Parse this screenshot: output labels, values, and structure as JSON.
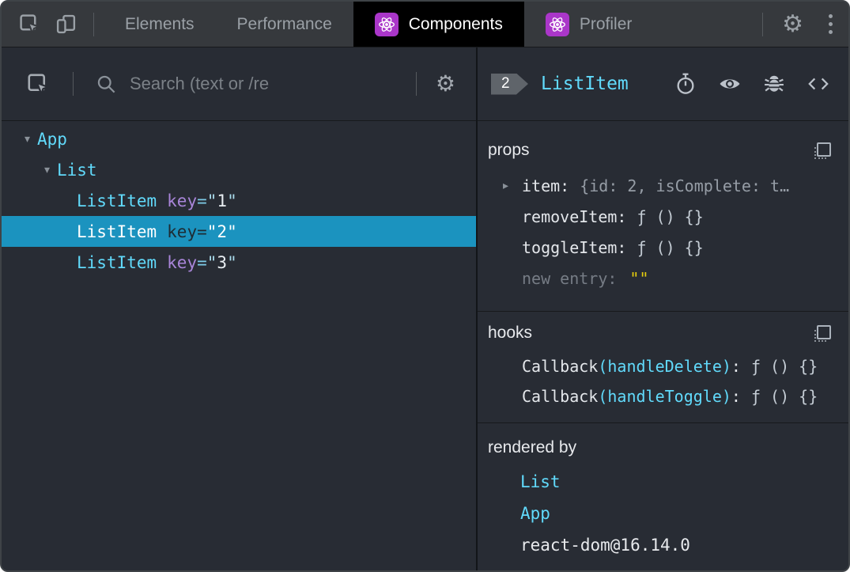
{
  "tabbar": {
    "tabs": [
      {
        "label": "Elements"
      },
      {
        "label": "Performance"
      },
      {
        "label": "Components",
        "active": true,
        "icon": "react-logo"
      },
      {
        "label": "Profiler",
        "icon": "react-logo"
      }
    ],
    "icons": [
      "inspect-cursor-icon",
      "device-toolbar-icon",
      "settings-gear-icon",
      "more-menu-icon"
    ],
    "gear_glyph": "⚙"
  },
  "left": {
    "toolbar_icons": [
      "inspect-cursor-icon",
      "search-icon",
      "settings-gear-icon"
    ],
    "search": {
      "placeholder": "Search (text or /re",
      "value": ""
    },
    "tree": [
      {
        "label": "App",
        "depth": 0,
        "expanded": true,
        "arrow": "▾"
      },
      {
        "label": "List",
        "depth": 1,
        "expanded": true,
        "arrow": "▾"
      },
      {
        "label": "ListItem",
        "depth": 2,
        "attr": "key",
        "eq": "=",
        "q": "\"",
        "value": "1"
      },
      {
        "label": "ListItem",
        "depth": 2,
        "attr": "key",
        "eq": "=",
        "q": "\"",
        "value": "2",
        "selected": true
      },
      {
        "label": "ListItem",
        "depth": 2,
        "attr": "key",
        "eq": "=",
        "q": "\"",
        "value": "3"
      }
    ]
  },
  "right": {
    "header": {
      "badge": "2",
      "title": "ListItem",
      "icons": [
        "suspense-stopwatch-icon",
        "inspect-dom-eye-icon",
        "log-bug-icon",
        "view-source-icon"
      ]
    },
    "props": {
      "title": "props",
      "rows": [
        {
          "arrow": "▸",
          "name": "item:",
          "value": "{id: 2, isComplete: t…"
        },
        {
          "name": "removeItem:",
          "value": "ƒ () {}"
        },
        {
          "name": "toggleItem:",
          "value": "ƒ () {}"
        },
        {
          "name": "new entry:",
          "value": "\"\"",
          "editable": true
        }
      ]
    },
    "hooks": {
      "title": "hooks",
      "rows": [
        {
          "name": "Callback",
          "fn": "(handleDelete)",
          "colon": ":",
          "value": "ƒ () {}"
        },
        {
          "name": "Callback",
          "fn": "(handleToggle)",
          "colon": ":",
          "value": "ƒ () {}"
        }
      ]
    },
    "rendered_by": {
      "title": "rendered by",
      "items": [
        {
          "label": "List",
          "link": true
        },
        {
          "label": "App",
          "link": true
        },
        {
          "label": "react-dom@16.14.0",
          "link": false
        }
      ]
    }
  },
  "colors": {
    "accent_component": "#61dafb",
    "selected_row_bg": "#1b93bf",
    "react_icon_bg": "#aa36c9",
    "key_attr": "#a885d8",
    "editable_value_yellow": "#e5cd0e",
    "tabbar_bg": "#36393d",
    "panel_bg": "#282c34",
    "active_tab_bg": "#000000"
  }
}
